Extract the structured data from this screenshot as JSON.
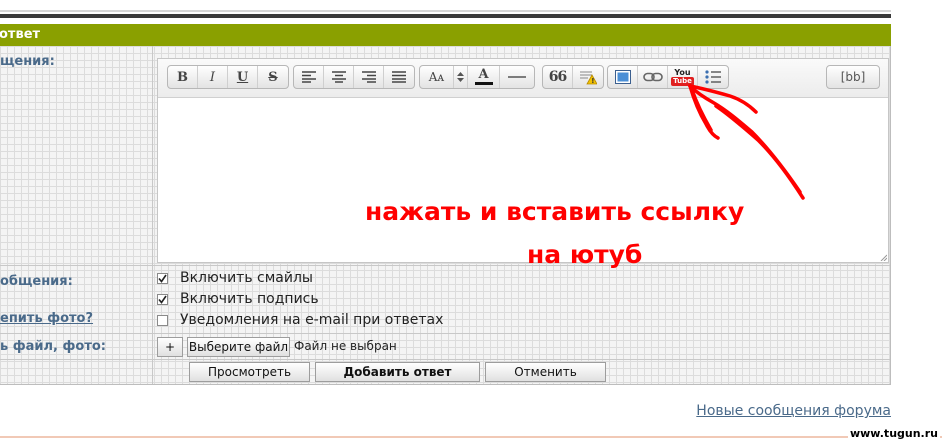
{
  "header": {
    "title": "ответ"
  },
  "labels": {
    "message": "щения:",
    "options": "общения:",
    "attach_photo": "епить фото?",
    "attach_file": "ь файл, фото:"
  },
  "toolbar": {
    "bold": "B",
    "italic": "I",
    "underline": "U",
    "strike": "S",
    "font_size": "Aᴀ",
    "font_color": "A",
    "quote": "66",
    "youtube_top": "You",
    "youtube_bottom": "Tube",
    "bbcode": "[bb]"
  },
  "annotation": {
    "line1": "нажать и вставить ссылку",
    "line2": "на ютуб",
    "color": "#ff0000"
  },
  "options": [
    {
      "label": "Включить смайлы",
      "checked": true
    },
    {
      "label": "Включить подпись",
      "checked": true
    },
    {
      "label": "Уведомления на e-mail при ответах",
      "checked": false
    }
  ],
  "attach": {
    "plus": "+",
    "choose_file": "Выберите файл",
    "no_file": "Файл не выбран"
  },
  "buttons": {
    "preview": "Просмотреть",
    "submit": "Добавить ответ",
    "cancel": "Отменить"
  },
  "links": {
    "new_messages": "Новые сообщения форума"
  },
  "watermark": "www.tugun.ru",
  "colors": {
    "title_bar": "#8aa000",
    "label": "#4a6a8a"
  }
}
